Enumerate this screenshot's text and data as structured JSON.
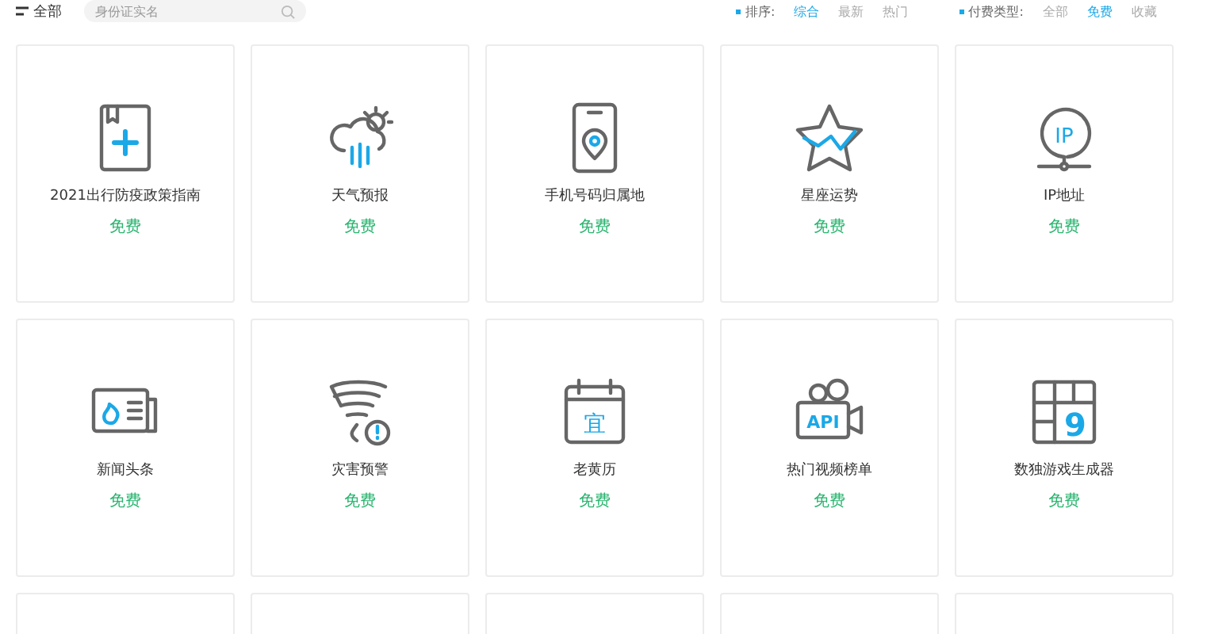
{
  "category": {
    "label": "全部"
  },
  "search": {
    "placeholder": "身份证实名"
  },
  "sort": {
    "label": "排序:",
    "options": [
      {
        "label": "综合",
        "selected": true
      },
      {
        "label": "最新",
        "selected": false
      },
      {
        "label": "热门",
        "selected": false
      }
    ]
  },
  "pay_type": {
    "label": "付费类型:",
    "options": [
      {
        "label": "全部",
        "selected": false
      },
      {
        "label": "免费",
        "selected": true
      },
      {
        "label": "收藏",
        "selected": false
      }
    ]
  },
  "cards": [
    {
      "kind": "book",
      "title": "2021出行防疫政策指南",
      "price": "免费"
    },
    {
      "kind": "weather",
      "title": "天气预报",
      "price": "免费"
    },
    {
      "kind": "phone",
      "title": "手机号码归属地",
      "price": "免费"
    },
    {
      "kind": "star",
      "title": "星座运势",
      "price": "免费"
    },
    {
      "kind": "ip",
      "glyph": "IP",
      "title": "IP地址",
      "price": "免费"
    },
    {
      "kind": "news",
      "title": "新闻头条",
      "price": "免费"
    },
    {
      "kind": "tornado",
      "title": "灾害预警",
      "price": "免费"
    },
    {
      "kind": "calendar",
      "glyph": "宜",
      "title": "老黄历",
      "price": "免费"
    },
    {
      "kind": "video",
      "glyph": "API",
      "title": "热门视频榜单",
      "price": "免费"
    },
    {
      "kind": "sudoku",
      "glyph": "9",
      "title": "数独游戏生成器",
      "price": "免费"
    }
  ]
}
